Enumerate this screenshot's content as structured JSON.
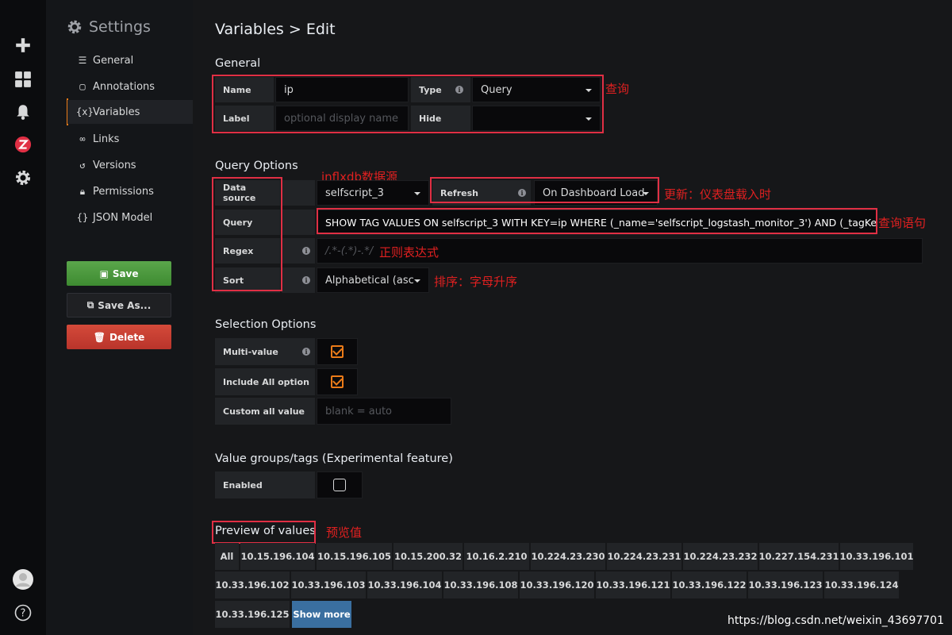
{
  "rail": {
    "icons": [
      "plus-icon",
      "dashboards-icon",
      "bell-icon",
      "z-logo-icon",
      "gear-icon",
      "user-avatar-icon",
      "help-icon"
    ]
  },
  "sidebar": {
    "title": "Settings",
    "items": [
      {
        "label": "General",
        "icon": "sliders-icon"
      },
      {
        "label": "Annotations",
        "icon": "comment-icon"
      },
      {
        "label": "Variables",
        "icon": "variable-icon"
      },
      {
        "label": "Links",
        "icon": "link-icon"
      },
      {
        "label": "Versions",
        "icon": "history-icon"
      },
      {
        "label": "Permissions",
        "icon": "lock-icon"
      },
      {
        "label": "JSON Model",
        "icon": "braces-icon"
      }
    ],
    "active": "Variables",
    "save_label": "Save",
    "save_as_label": "Save As...",
    "delete_label": "Delete"
  },
  "page": {
    "title": "Variables > Edit"
  },
  "general": {
    "heading": "General",
    "name_label": "Name",
    "name_value": "ip",
    "type_label": "Type",
    "type_value": "Query",
    "label_label": "Label",
    "label_placeholder": "optional display name",
    "hide_label": "Hide",
    "hide_value": ""
  },
  "query_options": {
    "heading": "Query Options",
    "datasource_label": "Data source",
    "datasource_value": "selfscript_3",
    "refresh_label": "Refresh",
    "refresh_value": "On Dashboard Load",
    "query_label": "Query",
    "query_value": "SHOW TAG VALUES ON selfscript_3 WITH KEY=ip WHERE (_name='selfscript_logstash_monitor_3') AND (_tagKey='ip')",
    "regex_label": "Regex",
    "regex_placeholder": "/.*-(.*)-.*/",
    "sort_label": "Sort",
    "sort_value": "Alphabetical (asc"
  },
  "selection_options": {
    "heading": "Selection Options",
    "multi_label": "Multi-value",
    "multi_checked": true,
    "include_all_label": "Include All option",
    "include_all_checked": true,
    "custom_all_label": "Custom all value",
    "custom_all_placeholder": "blank = auto"
  },
  "value_groups": {
    "heading": "Value groups/tags (Experimental feature)",
    "enabled_label": "Enabled",
    "enabled_checked": false
  },
  "preview": {
    "heading": "Preview of values",
    "values": [
      "All",
      "10.15.196.104",
      "10.15.196.105",
      "10.15.200.32",
      "10.16.2.210",
      "10.224.23.230",
      "10.224.23.231",
      "10.224.23.232",
      "10.227.154.231",
      "10.33.196.101",
      "10.33.196.102",
      "10.33.196.103",
      "10.33.196.104",
      "10.33.196.108",
      "10.33.196.120",
      "10.33.196.121",
      "10.33.196.122",
      "10.33.196.123",
      "10.33.196.124",
      "10.33.196.125"
    ],
    "show_more_label": "Show more"
  },
  "annotations": {
    "type_note": "查询",
    "datasource_note": "inflxdb数据源",
    "refresh_note": "更新：仪表盘载入时",
    "query_note": "查询语句",
    "regex_note": "正则表达式",
    "sort_note": "排序：字母升序",
    "preview_note": "预览值"
  },
  "watermark": "https://blog.csdn.net/weixin_43697701",
  "colors": {
    "accent": "#eb7b18",
    "annotation_red": "#e02f44",
    "save_green": "#3e8b31",
    "delete_red": "#b9342b",
    "show_more_blue": "#3a6fa0"
  }
}
